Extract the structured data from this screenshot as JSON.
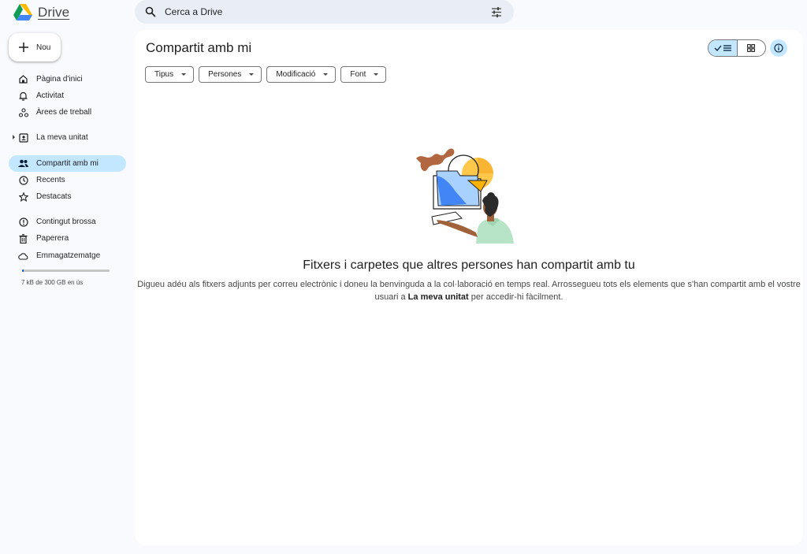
{
  "app": {
    "name": "Drive"
  },
  "search": {
    "placeholder": "Cerca a Drive"
  },
  "sidebar": {
    "new_label": "Nou",
    "items": [
      {
        "label": "Pàgina d'inici"
      },
      {
        "label": "Activitat"
      },
      {
        "label": "Àrees de treball"
      },
      {
        "label": "La meva unitat"
      },
      {
        "label": "Compartit amb mi"
      },
      {
        "label": "Recents"
      },
      {
        "label": "Destacats"
      },
      {
        "label": "Contingut brossa"
      },
      {
        "label": "Paperera"
      },
      {
        "label": "Emmagatzematge"
      }
    ],
    "storage": {
      "text": "7 kB de 300 GB en ús",
      "fraction": 2e-05
    }
  },
  "main": {
    "title": "Compartit amb mi",
    "filters": [
      "Tipus",
      "Persones",
      "Modificació",
      "Font"
    ],
    "empty_state": {
      "title": "Fitxers i carpetes que altres persones han compartit amb tu",
      "desc_part1": "Digueu adéu als fitxers adjunts per correu electrònic i doneu la benvinguda a la col·laboració en temps real. Arrossegueu tots els elements que s'han compartit amb el vostre usuari a ",
      "desc_bold": "La meva unitat",
      "desc_part2": " per accedir-hi fàcilment."
    }
  },
  "colors": {
    "background": "#f8fafd",
    "active": "#c2e7ff",
    "search_bg": "#e9eef6",
    "accent_blue": "#0b57d0"
  },
  "icons": {
    "search": "search-icon",
    "filter": "tune-icon",
    "new": "plus-icon",
    "list_view": "list-view-icon",
    "grid_view": "grid-view-icon",
    "info": "info-icon"
  }
}
